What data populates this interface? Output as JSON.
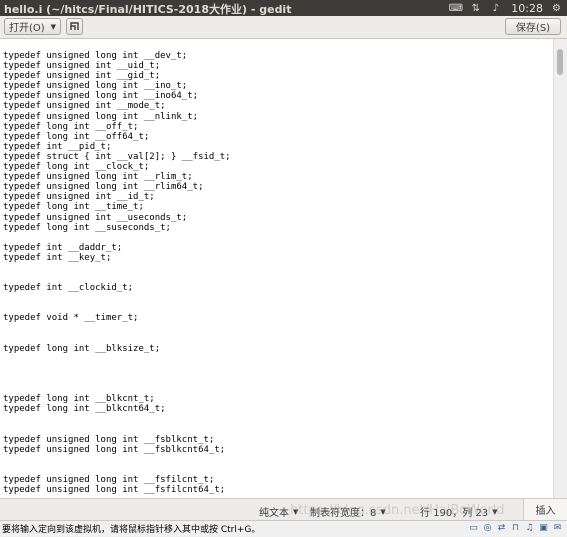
{
  "window": {
    "title": "hello.i (~/hitcs/Final/HITICS-2018大作业) - gedit"
  },
  "tray": {
    "icons": [
      "keyboard-icon",
      "network-icon",
      "volume-icon"
    ],
    "clock": "10:28"
  },
  "toolbar": {
    "open_label": "打开(O)",
    "save_label": "保存(S)"
  },
  "editor": {
    "lines": [
      "typedef unsigned long int __dev_t;",
      "typedef unsigned int __uid_t;",
      "typedef unsigned int __gid_t;",
      "typedef unsigned long int __ino_t;",
      "typedef unsigned long int __ino64_t;",
      "typedef unsigned int __mode_t;",
      "typedef unsigned long int __nlink_t;",
      "typedef long int __off_t;",
      "typedef long int __off64_t;",
      "typedef int __pid_t;",
      "typedef struct { int __val[2]; } __fsid_t;",
      "typedef long int __clock_t;",
      "typedef unsigned long int __rlim_t;",
      "typedef unsigned long int __rlim64_t;",
      "typedef unsigned int __id_t;",
      "typedef long int __time_t;",
      "typedef unsigned int __useconds_t;",
      "typedef long int __suseconds_t;",
      "",
      "typedef int __daddr_t;",
      "typedef int __key_t;",
      "",
      "",
      "typedef int __clockid_t;",
      "",
      "",
      "typedef void * __timer_t;",
      "",
      "",
      "typedef long int __blksize_t;",
      "",
      "",
      "",
      "",
      "typedef long int __blkcnt_t;",
      "typedef long int __blkcnt64_t;",
      "",
      "",
      "typedef unsigned long int __fsblkcnt_t;",
      "typedef unsigned long int __fsblkcnt64_t;",
      "",
      "",
      "typedef unsigned long int __fsfilcnt_t;",
      "typedef unsigned long int __fsfilcnt64_t;"
    ]
  },
  "statusbar": {
    "language": "纯文本",
    "tab_width": "制表符宽度：8",
    "position": "行 190，列 23",
    "insert_mode": "插入"
  },
  "vm": {
    "hint": "要将输入定向到该虚拟机，请将鼠标指针移入其中或按 Ctrl+G。"
  },
  "watermark": "https://blog.csdn.net/HaiBoWorld"
}
